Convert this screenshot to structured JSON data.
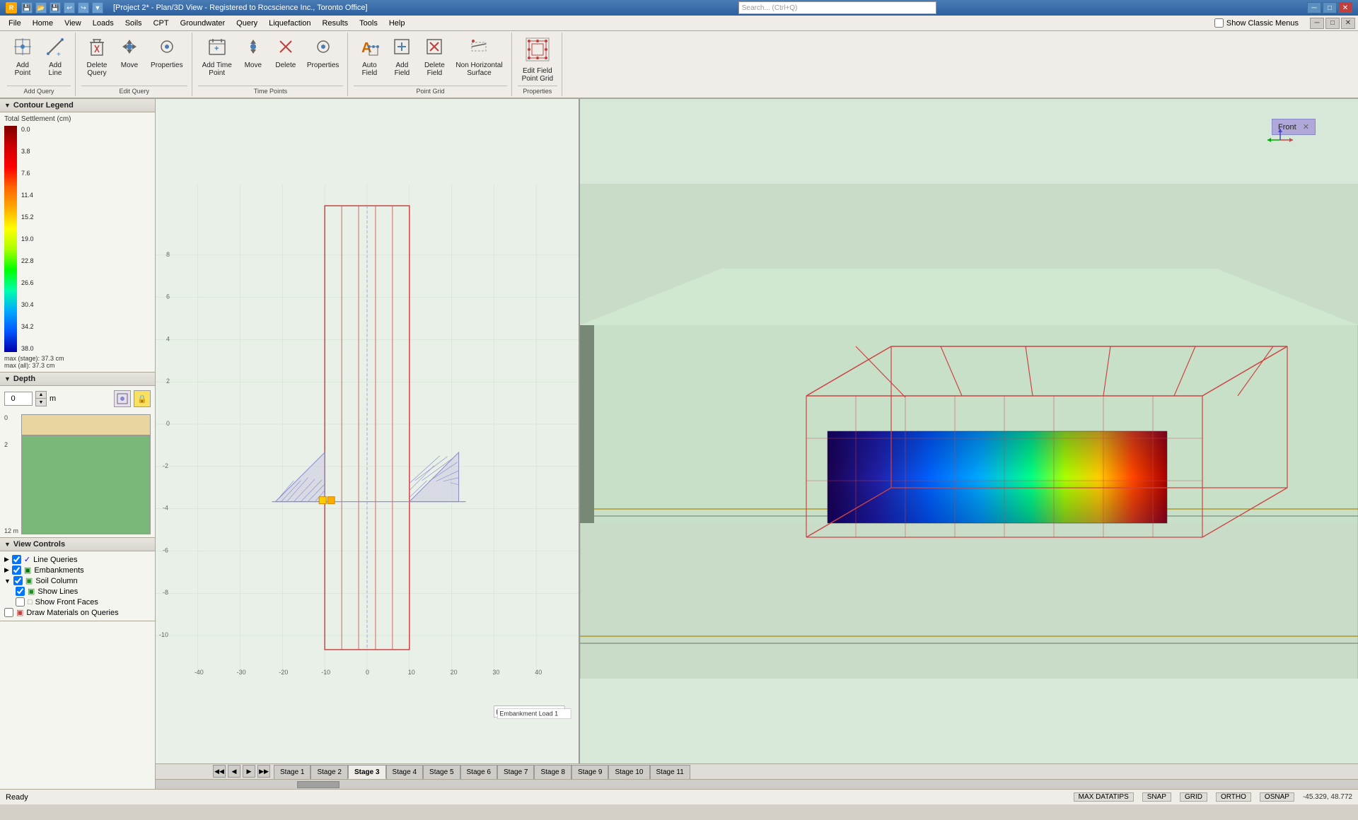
{
  "titlebar": {
    "title": "[Project 2* - Plan/3D View - Registered to Rocscience Inc., Toronto Office]",
    "search_placeholder": "Search... (Ctrl+Q)",
    "icons": [
      "disk",
      "folder",
      "disk2",
      "undo",
      "redo",
      "arrow"
    ]
  },
  "menubar": {
    "items": [
      "File",
      "Home",
      "View",
      "Loads",
      "Soils",
      "CPT",
      "Groundwater",
      "Query",
      "Liquefaction",
      "Results",
      "Tools",
      "Help"
    ]
  },
  "ribbon": {
    "show_classic": "Show Classic Menus",
    "groups": [
      {
        "label": "Add Query",
        "buttons": [
          {
            "icon": "⊕",
            "label": "Add\nPoint"
          },
          {
            "icon": "⊕",
            "label": "Add\nLine"
          }
        ]
      },
      {
        "label": "Edit Query",
        "buttons": [
          {
            "icon": "✕",
            "label": "Delete\nQuery"
          },
          {
            "icon": "↔",
            "label": "Move"
          },
          {
            "icon": "⚙",
            "label": "Properties"
          }
        ]
      },
      {
        "label": "Time Points",
        "buttons": [
          {
            "icon": "⊕",
            "label": "Add Time\nPoint"
          },
          {
            "icon": "↔",
            "label": "Move"
          },
          {
            "icon": "✕",
            "label": "Delete"
          },
          {
            "icon": "⚙",
            "label": "Properties"
          }
        ]
      },
      {
        "label": "Point Grid",
        "buttons": [
          {
            "icon": "A",
            "label": "Auto\nField"
          },
          {
            "icon": "⊕",
            "label": "Add\nField"
          },
          {
            "icon": "✕",
            "label": "Delete\nField"
          },
          {
            "icon": "⊘",
            "label": "Non Horizontal\nSurface"
          }
        ]
      },
      {
        "label": "Properties",
        "buttons": [
          {
            "icon": "⊞",
            "label": "Edit Field\nPoint Grid"
          }
        ]
      }
    ]
  },
  "left_panel": {
    "contour_legend": {
      "title": "Contour Legend",
      "sub_title": "Total Settlement (cm)",
      "values": [
        "0.0",
        "3.8",
        "7.6",
        "11.4",
        "15.2",
        "19.0",
        "22.8",
        "26.6",
        "30.4",
        "34.2",
        "38.0"
      ],
      "max_stage": "max (stage): 37.3 cm",
      "max_all": "max (all):   37.3 cm"
    },
    "depth": {
      "title": "Depth",
      "value": "0",
      "unit": "m"
    },
    "view_controls": {
      "title": "View Controls",
      "items": [
        {
          "label": "Line Queries",
          "checked": true,
          "level": 0
        },
        {
          "label": "Embankments",
          "checked": true,
          "level": 0
        },
        {
          "label": "Soil Column",
          "checked": true,
          "level": 0
        },
        {
          "label": "Show Lines",
          "checked": true,
          "level": 1
        },
        {
          "label": "Show Front Faces",
          "checked": false,
          "level": 1
        },
        {
          "label": "Draw Materials on Queries",
          "checked": false,
          "level": 0
        }
      ]
    }
  },
  "stages": {
    "nav_buttons": [
      "◀◀",
      "◀",
      "▶",
      "▶▶"
    ],
    "tabs": [
      "Stage 1",
      "Stage 2",
      "Stage 3",
      "Stage 4",
      "Stage 5",
      "Stage 6",
      "Stage 7",
      "Stage 8",
      "Stage 9",
      "Stage 10",
      "Stage 11"
    ],
    "active": "Stage 3"
  },
  "statusbar": {
    "ready": "Ready",
    "items": [
      "MAX DATATIPS",
      "SNAP",
      "GRID",
      "ORTHO",
      "OSNAP"
    ],
    "active_items": [],
    "coords": "-45.329, 48.772"
  },
  "viewport": {
    "plan_label": "Embankment Load 1",
    "front_label": "Front"
  }
}
